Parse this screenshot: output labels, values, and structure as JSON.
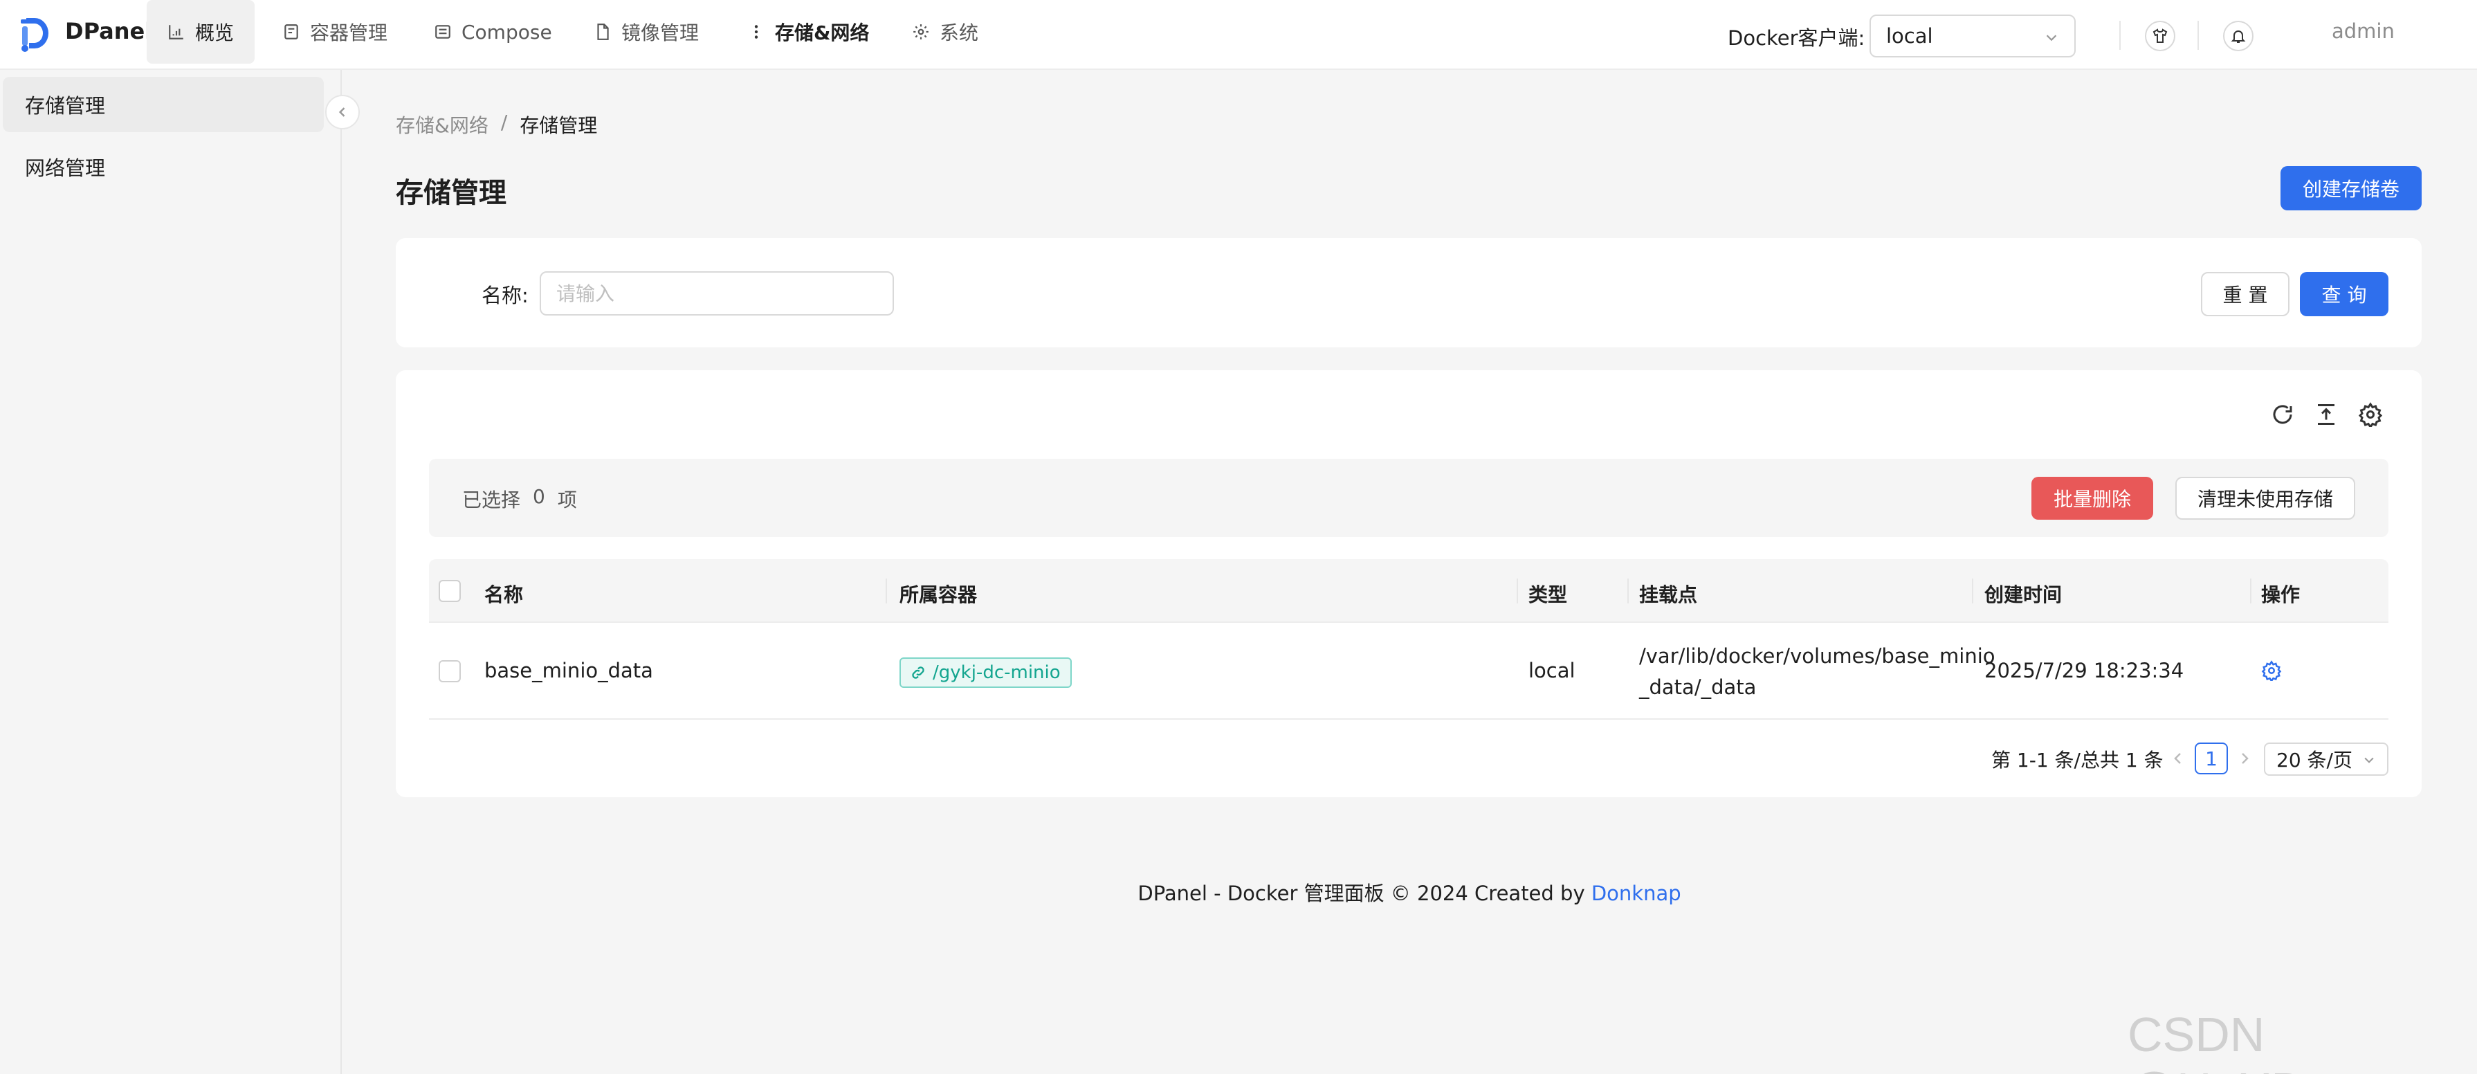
{
  "app": {
    "brand": "DPanel"
  },
  "nav": {
    "items": [
      {
        "label": "概览",
        "icon": "chart-icon"
      },
      {
        "label": "容器管理",
        "icon": "container-icon"
      },
      {
        "label": "Compose",
        "icon": "compose-icon"
      },
      {
        "label": "镜像管理",
        "icon": "file-icon"
      },
      {
        "label": "存储&网络",
        "icon": "more-vertical-icon"
      },
      {
        "label": "系统",
        "icon": "gear-icon"
      }
    ],
    "selected": "存储&网络"
  },
  "header": {
    "client_label": "Docker客户端:",
    "client_value": "local",
    "user": "admin"
  },
  "sidebar": {
    "items": [
      {
        "label": "存储管理"
      },
      {
        "label": "网络管理"
      }
    ]
  },
  "breadcrumb": {
    "parent": "存储&网络",
    "separator": "/",
    "current": "存储管理"
  },
  "page": {
    "title": "存储管理",
    "create_button": "创建存储卷"
  },
  "search": {
    "name_label": "名称:",
    "name_placeholder": "请输入",
    "reset_label": "重 置",
    "query_label": "查 询"
  },
  "selection": {
    "prefix": "已选择",
    "count": "0",
    "suffix": "项"
  },
  "actions": {
    "batch_delete": "批量删除",
    "prune_unused": "清理未使用存储"
  },
  "table": {
    "columns": [
      "名称",
      "所属容器",
      "类型",
      "挂载点",
      "创建时间",
      "操作"
    ],
    "rows": [
      {
        "name": "base_minio_data",
        "container": "/gykj-dc-minio",
        "type": "local",
        "mount_line1": "/var/lib/docker/volumes/base_minio",
        "mount_line2": "_data/_data",
        "created": "2025/7/29 18:23:34"
      }
    ]
  },
  "pagination": {
    "summary": "第 1-1 条/总共 1 条",
    "page": "1",
    "page_size": "20 条/页"
  },
  "footer": {
    "text": "DPanel - Docker 管理面板 © 2024 Created by",
    "link": "Donknap"
  },
  "watermark": "CSDN @HeXDev",
  "colors": {
    "primary": "#2f6fed",
    "danger": "#e85858",
    "tag": "#13a58f"
  }
}
